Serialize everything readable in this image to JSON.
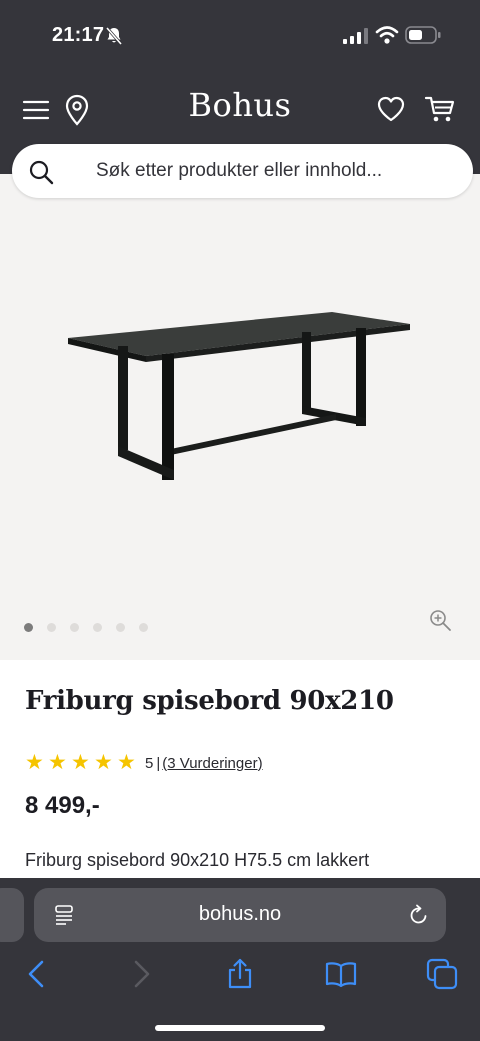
{
  "status_bar": {
    "time": "21:17",
    "icons": [
      "bell-slash-icon",
      "signal-icon",
      "wifi-icon",
      "battery-icon"
    ]
  },
  "header": {
    "logo": "Bohus",
    "icons": [
      "menu-icon",
      "location-icon",
      "heart-icon",
      "cart-icon"
    ]
  },
  "search": {
    "placeholder": "Søk etter produkter eller innhold..."
  },
  "gallery": {
    "image_count": 6,
    "active_index": 0
  },
  "product": {
    "title": "Friburg spisebord 90x210",
    "rating": {
      "stars": 5,
      "value": "5",
      "separator": "|",
      "reviews_link": "(3 Vurderinger)"
    },
    "price": "8 499,-",
    "description": "Friburg spisebord 90x210 H75.5 cm lakkert"
  },
  "browser": {
    "url": "bohus.no",
    "nav_icons": [
      "back-icon",
      "forward-icon",
      "share-icon",
      "bookmarks-icon",
      "tabs-icon"
    ]
  },
  "colors": {
    "header_bg": "#35353b",
    "gallery_bg": "#f4f3f2",
    "star": "#f5c400",
    "browser_accent": "#3e8ef7"
  }
}
